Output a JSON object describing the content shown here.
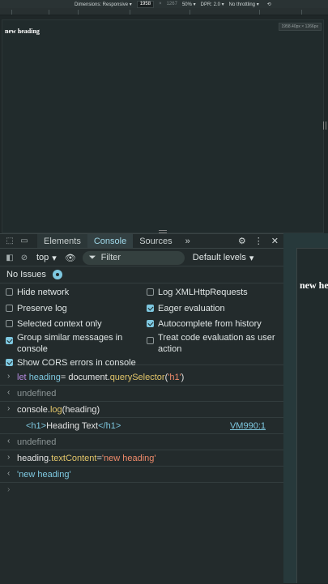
{
  "device_toolbar": {
    "dimensions_label": "Dimensions: Responsive ▾",
    "width": "1958",
    "times": "×",
    "height": "1267",
    "zoom": "50% ▾",
    "dpr": "DPR: 2.0 ▾",
    "throttle": "No throttling ▾",
    "size_badge": "1958.40px × 1266px"
  },
  "page": {
    "heading": "new heading"
  },
  "devtools": {
    "tabs": [
      "Elements",
      "Console",
      "Sources"
    ],
    "active_tab": "Console",
    "more_tabs": "»",
    "context": "top",
    "filter_placeholder": "Filter",
    "levels": "Default levels",
    "issues": "No Issues"
  },
  "settings": {
    "hide_network": {
      "label": "Hide network",
      "checked": false
    },
    "preserve_log": {
      "label": "Preserve log",
      "checked": false
    },
    "selected_context": {
      "label": "Selected context only",
      "checked": false
    },
    "group_similar": {
      "label": "Group similar messages in console",
      "checked": true
    },
    "cors_errors": {
      "label": "Show CORS errors in console",
      "checked": true
    },
    "log_xhr": {
      "label": "Log XMLHttpRequests",
      "checked": false
    },
    "eager_eval": {
      "label": "Eager evaluation",
      "checked": true
    },
    "autocomplete": {
      "label": "Autocomplete from history",
      "checked": true
    },
    "user_action": {
      "label": "Treat code evaluation as user action",
      "checked": false
    }
  },
  "console": {
    "l1": {
      "kw": "let",
      "var": "heading",
      "eq": " = document.",
      "fn": "querySelector",
      "open": "(",
      "str": "'h1'",
      "close": ")"
    },
    "undef1": "undefined",
    "l2": {
      "obj": "console.",
      "fn": "log",
      "args": "(heading)"
    },
    "l2_out": {
      "open_tag": "<h1>",
      "text": "Heading Text",
      "close_tag": "</h1>",
      "source": "VM990:1"
    },
    "undef2": "undefined",
    "l3": {
      "lhs": "heading.",
      "prop": "textContent",
      "eq": " = ",
      "str": "'new heading'"
    },
    "l3_out": "'new heading'"
  }
}
